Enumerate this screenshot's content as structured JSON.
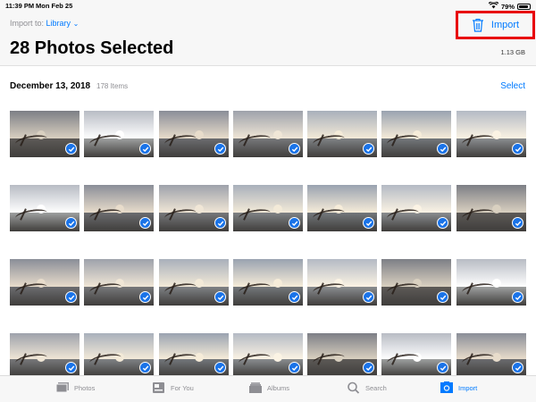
{
  "status": {
    "time": "11:39 PM",
    "date": "Mon Feb 25",
    "battery": "79%",
    "battery_level": 0.79
  },
  "header": {
    "import_to_label": "Import to:",
    "import_destination": "Library",
    "title": "28 Photos Selected",
    "size": "1.13 GB",
    "import_button": "Import",
    "delete_icon": "trash-icon"
  },
  "section": {
    "date": "December 13, 2018",
    "count": "178 Items",
    "select_label": "Select"
  },
  "photos": {
    "selected_icon": "checkmark-icon",
    "rows": 4,
    "columns": 7
  },
  "tabbar": {
    "tabs": [
      {
        "label": "Photos",
        "icon": "photos-icon",
        "active": false
      },
      {
        "label": "For You",
        "icon": "for-you-icon",
        "active": false
      },
      {
        "label": "Albums",
        "icon": "albums-icon",
        "active": false
      },
      {
        "label": "Search",
        "icon": "search-icon",
        "active": false
      },
      {
        "label": "Import",
        "icon": "import-camera-icon",
        "active": true
      }
    ]
  },
  "colors": {
    "accent": "#007aff",
    "highlight_box": "#e8000a",
    "check": "#1a73e8"
  }
}
